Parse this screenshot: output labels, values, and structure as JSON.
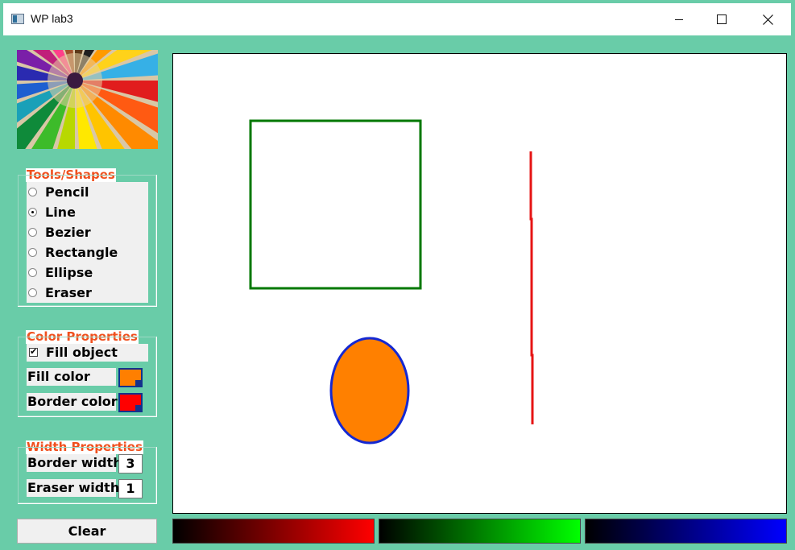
{
  "window": {
    "title": "WP lab3",
    "controls": [
      "minimize-icon",
      "maximize-icon",
      "close-icon"
    ]
  },
  "tools": {
    "legend": "Tools/Shapes",
    "selected": "Line",
    "items": [
      "Pencil",
      "Line",
      "Bezier",
      "Rectangle",
      "Ellipse",
      "Eraser"
    ]
  },
  "color_props": {
    "legend": "Color Properties",
    "fill_object_label": "Fill object",
    "fill_object_checked": true,
    "fill_color_label": "Fill color",
    "fill_color": "#ff7f00",
    "border_color_label": "Border color",
    "border_color": "#ff0000"
  },
  "width_props": {
    "legend": "Width Properties",
    "border_width_label": "Border width",
    "border_width_value": "3",
    "eraser_width_label": "Eraser width",
    "eraser_width_value": "1"
  },
  "clear_button": "Clear",
  "colors": {
    "background": "#69cca8",
    "legend_text": "#f0501e",
    "rectangle_stroke": "#007800",
    "ellipse_fill": "#ff8000",
    "ellipse_stroke": "#1428d2",
    "line_stroke": "#e61414"
  },
  "sliders": [
    {
      "channel": "red",
      "from": "#000000",
      "to": "#ff0000"
    },
    {
      "channel": "green",
      "from": "#000000",
      "to": "#00ff00"
    },
    {
      "channel": "blue",
      "from": "#000000",
      "to": "#0000ff"
    }
  ]
}
